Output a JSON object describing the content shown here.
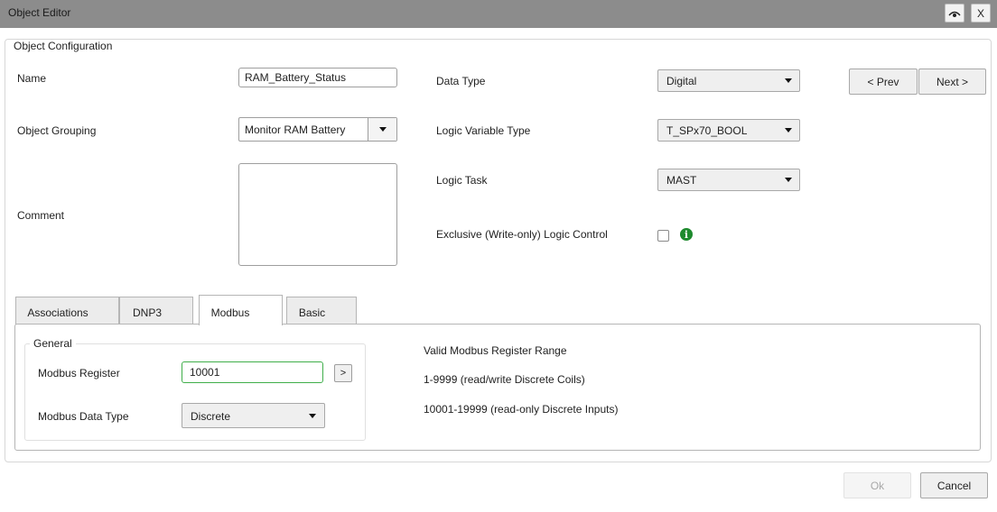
{
  "window": {
    "title": "Object Editor",
    "close_label": "X"
  },
  "config": {
    "legend": "Object Configuration",
    "name_label": "Name",
    "name_value": "RAM_Battery_Status",
    "grouping_label": "Object Grouping",
    "grouping_value": "Monitor RAM Battery",
    "comment_label": "Comment",
    "comment_value": "",
    "data_type_label": "Data Type",
    "data_type_value": "Digital",
    "logic_var_label": "Logic Variable Type",
    "logic_var_value": "T_SPx70_BOOL",
    "logic_task_label": "Logic Task",
    "logic_task_value": "MAST",
    "exclusive_label": "Exclusive (Write-only) Logic Control",
    "exclusive_checked": false,
    "info_glyph": "i",
    "prev_label": "< Prev",
    "next_label": "Next >"
  },
  "tabs": [
    {
      "label": "Associations",
      "active": false
    },
    {
      "label": "DNP3",
      "active": false
    },
    {
      "label": "Modbus",
      "active": true
    },
    {
      "label": "Basic",
      "active": false
    }
  ],
  "modbus": {
    "general_legend": "General",
    "register_label": "Modbus Register",
    "register_value": "10001",
    "go_label": ">",
    "data_type_label": "Modbus Data Type",
    "data_type_value": "Discrete",
    "range_title": "Valid Modbus Register Range",
    "range_lines": [
      "1-9999 (read/write Discrete Coils)",
      "10001-19999 (read-only Discrete Inputs)"
    ]
  },
  "footer": {
    "ok_label": "Ok",
    "cancel_label": "Cancel"
  },
  "icons": {
    "eye": "eye-icon",
    "info": "info-icon",
    "caret": "chevron-down-icon"
  },
  "colors": {
    "titlebar": "#8c8c8c",
    "info_green": "#1e8a2e",
    "focus_green": "#3fae4a"
  }
}
